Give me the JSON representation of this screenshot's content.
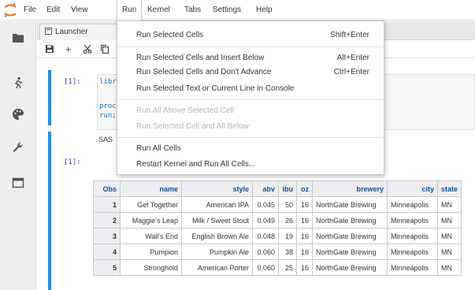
{
  "menubar": {
    "logo_icon": "jupyter-logo",
    "items": [
      "File",
      "Edit",
      "View",
      "Run",
      "Kernel",
      "Tabs",
      "Settings",
      "Help"
    ],
    "active": "Run"
  },
  "sidebar": {
    "icons": [
      "folder-icon",
      "running-icon",
      "palette-icon",
      "wrench-icon",
      "tabs-icon"
    ]
  },
  "tabbar": {
    "tab_label": "Launcher"
  },
  "toolbar": {
    "icons": [
      "save-icon",
      "add-cell-icon",
      "cut-icon",
      "copy-icon"
    ]
  },
  "notebook": {
    "cell1": {
      "prompt": "[1]:",
      "lines": [
        "libr",
        "proc",
        "run;"
      ]
    },
    "output1": {
      "text": "SAS"
    },
    "cell2": {
      "prompt": "[1]:"
    }
  },
  "run_menu": {
    "items": [
      {
        "label": "Run Selected Cells",
        "shortcut": "Shift+Enter",
        "disabled": false
      },
      {
        "label": "Run Selected Cells and Insert Below",
        "shortcut": "Alt+Enter",
        "disabled": false
      },
      {
        "label": "Run Selected Cells and Don't Advance",
        "shortcut": "Ctrl+Enter",
        "disabled": false
      },
      {
        "label": "Run Selected Text or Current Line in Console",
        "shortcut": "",
        "disabled": false
      },
      {
        "label": "Run All Above Selected Cell",
        "shortcut": "",
        "disabled": true
      },
      {
        "label": "Run Selected Cell and All Below",
        "shortcut": "",
        "disabled": true
      },
      {
        "label": "Run All Cells",
        "shortcut": "",
        "disabled": false
      },
      {
        "label": "Restart Kernel and Run All Cells...",
        "shortcut": "",
        "disabled": false
      }
    ]
  },
  "table": {
    "headers": [
      "Obs",
      "name",
      "style",
      "abv",
      "ibu",
      "oz",
      "brewery",
      "city",
      "state"
    ],
    "rows": [
      [
        "1",
        "Get Together",
        "American IPA",
        "0.045",
        "50",
        "16",
        "NorthGate Brewing",
        "Minneapolis",
        "MN"
      ],
      [
        "2",
        "Maggie's Leap",
        "Milk / Sweet Stout",
        "0.049",
        "26",
        "16",
        "NorthGate Brewing",
        "Minneapolis",
        "MN"
      ],
      [
        "3",
        "Wall's End",
        "English Brown Ale",
        "0.048",
        "19",
        "16",
        "NorthGate Brewing",
        "Minneapolis",
        "MN"
      ],
      [
        "4",
        "Pumpion",
        "Pumpkin Ale",
        "0.060",
        "38",
        "16",
        "NorthGate Brewing",
        "Minneapolis",
        "MN"
      ],
      [
        "5",
        "Stronghold",
        "American Porter",
        "0.060",
        "25",
        "16",
        "NorthGate Brewing",
        "Minneapolis",
        "MN"
      ]
    ]
  },
  "colors": {
    "accent": "#2a8bd6",
    "logo_orange": "#f37726",
    "header_text": "#1a4d8f",
    "prompt": "#303f9f"
  }
}
